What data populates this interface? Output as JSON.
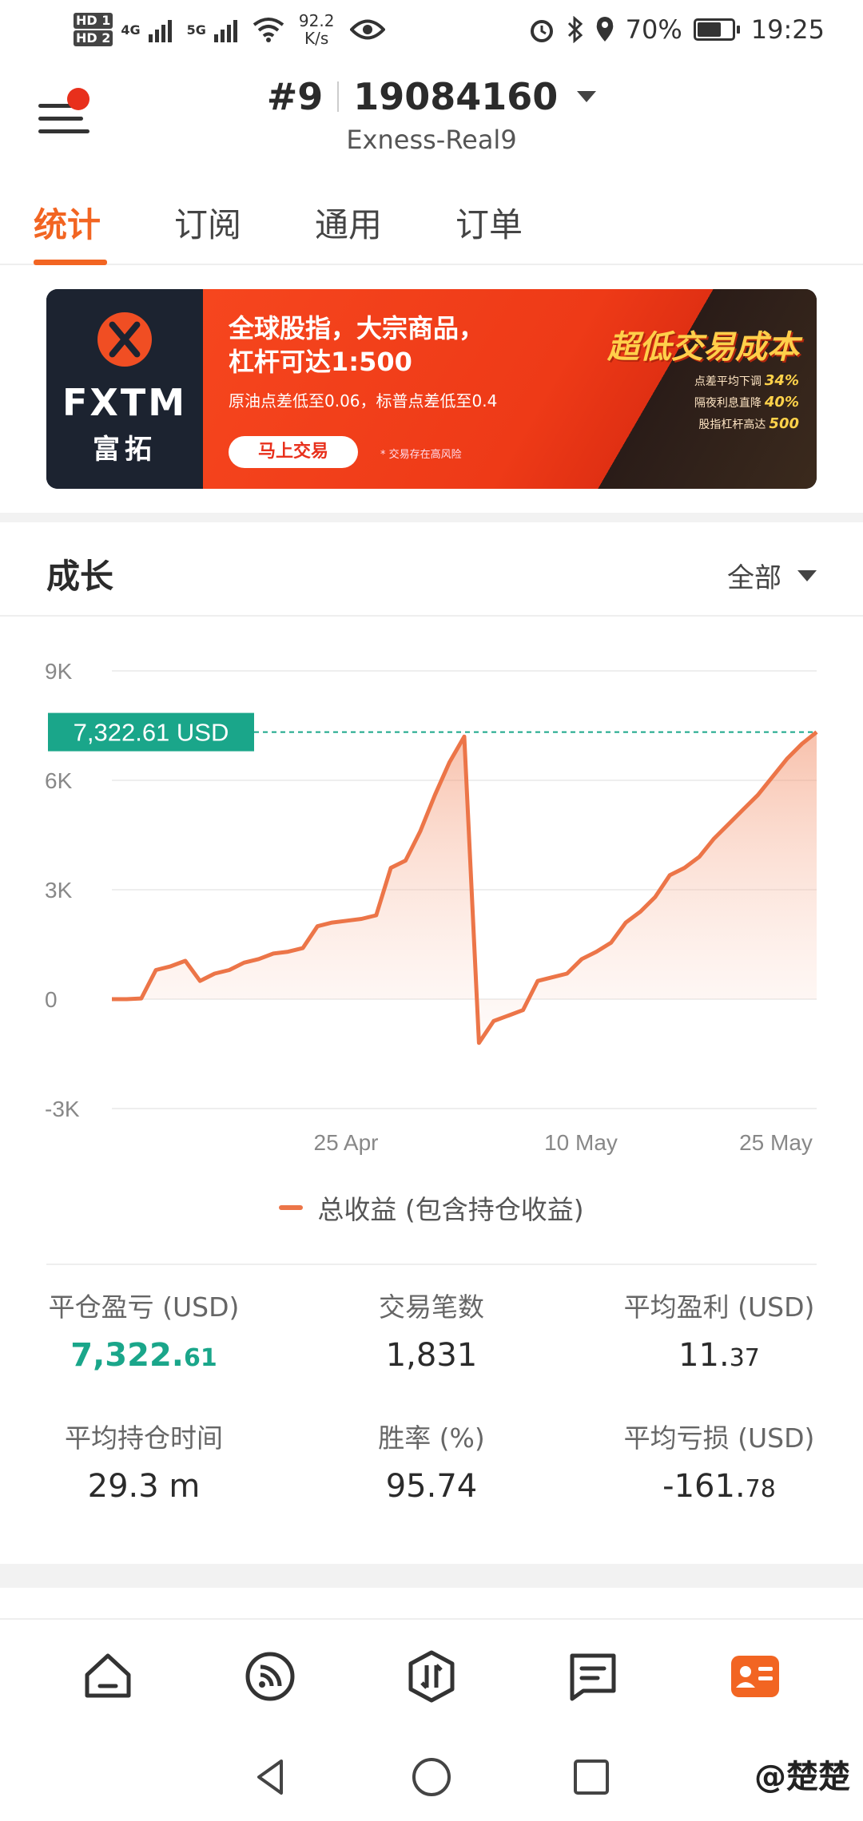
{
  "status_bar": {
    "hd1": "HD 1",
    "hd2": "HD 2",
    "net_4g": "4G",
    "net_5g": "5G",
    "speed_value": "92.2",
    "speed_unit": "K/s",
    "battery": "70%",
    "battery_level_percent": 70,
    "time": "19:25"
  },
  "header": {
    "account_number_prefix": "#9",
    "account_id": "19084160",
    "server": "Exness-Real9"
  },
  "tabs": [
    {
      "label": "统计",
      "active": true
    },
    {
      "label": "订阅",
      "active": false
    },
    {
      "label": "通用",
      "active": false
    },
    {
      "label": "订单",
      "active": false
    }
  ],
  "banner": {
    "brand": "FXTM",
    "brand_cn": "富拓",
    "headline_1": "全球股指，大宗商品，",
    "headline_2": "杠杆可达1:500",
    "subline": "原油点差低至0.06，标普点差低至0.4",
    "cta": "马上交易",
    "risk": "* 交易存在高风险",
    "slogan": "超低交易成本",
    "stat1_label": "点差平均下调",
    "stat1_value": "34%",
    "stat2_label": "隔夜利息直降",
    "stat2_value": "40%",
    "stat3_label": "股指杠杆高达",
    "stat3_value": "500"
  },
  "growth": {
    "title": "成长",
    "range": "全部"
  },
  "chart_data": {
    "type": "area",
    "title": "",
    "xlabel": "",
    "ylabel": "",
    "ylim": [
      -3000,
      9000
    ],
    "yticks": [
      "9K",
      "6K",
      "3K",
      "0",
      "-3K"
    ],
    "ytick_values": [
      9000,
      6000,
      3000,
      0,
      -3000
    ],
    "xticks": [
      "25 Apr",
      "10 May",
      "25 May"
    ],
    "current_value_label": "7,322.61 USD",
    "current_value": 7322.61,
    "series": [
      {
        "name": "总收益 (包含持仓收益)",
        "color": "#ec7548",
        "values": [
          0,
          0,
          20,
          800,
          900,
          1050,
          500,
          700,
          800,
          1000,
          1100,
          1250,
          1300,
          1400,
          2000,
          2100,
          2150,
          2200,
          2300,
          3600,
          3800,
          4600,
          5600,
          6500,
          7200,
          -1200,
          -600,
          -450,
          -300,
          500,
          600,
          700,
          1100,
          1300,
          1550,
          2100,
          2400,
          2800,
          3400,
          3600,
          3900,
          4400,
          4800,
          5200,
          5600,
          6100,
          6600,
          7000,
          7322.61
        ]
      }
    ]
  },
  "legend_label": "总收益 (包含持仓收益)",
  "stats": {
    "closed_pnl_label": "平仓盈亏 (USD)",
    "closed_pnl_int": "7,322.",
    "closed_pnl_dec": "61",
    "trades_label": "交易笔数",
    "trades_value": "1,831",
    "avg_profit_label": "平均盈利 (USD)",
    "avg_profit_int": "11.",
    "avg_profit_dec": "37",
    "avg_hold_label": "平均持仓时间",
    "avg_hold_value": "29.3 m",
    "win_rate_label": "胜率 (%)",
    "win_rate_value": "95.74",
    "avg_loss_label": "平均亏损 (USD)",
    "avg_loss_int": "-161.",
    "avg_loss_dec": "78"
  },
  "nav": {
    "items": [
      "home-icon",
      "feed-icon",
      "trade-icon",
      "news-icon",
      "profile-card-icon"
    ],
    "active_index": 4,
    "active_color": "#f26522"
  },
  "watermark": "@楚楚"
}
